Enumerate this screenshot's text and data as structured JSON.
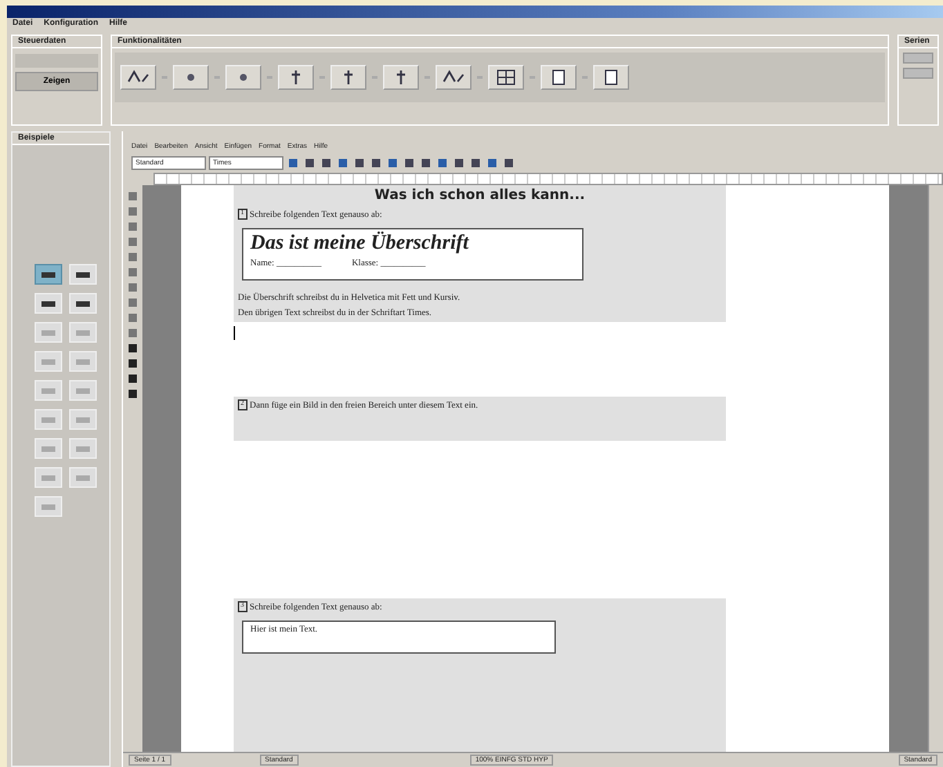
{
  "menu": [
    "Datei",
    "Konfiguration",
    "Hilfe"
  ],
  "control_group": {
    "title": "Steuerdaten",
    "button": "Zeigen"
  },
  "functions_group": {
    "title": "Funktionalitäten"
  },
  "side_group": {
    "title": "Serien"
  },
  "examples_panel": {
    "title": "Beispiele",
    "items": [
      {
        "selected": true
      },
      {
        "selected": false
      },
      {
        "selected": false
      },
      {
        "selected": false
      },
      {
        "selected": false
      },
      {
        "selected": false
      },
      {
        "selected": false
      },
      {
        "selected": false
      },
      {
        "selected": false
      },
      {
        "selected": false
      },
      {
        "selected": false
      },
      {
        "selected": false
      },
      {
        "selected": false
      },
      {
        "selected": false
      },
      {
        "selected": false
      },
      {
        "selected": false
      },
      {
        "selected": false
      }
    ]
  },
  "editor": {
    "menu": [
      "Datei",
      "Bearbeiten",
      "Ansicht",
      "Einfügen",
      "Format",
      "Extras",
      "Hilfe"
    ],
    "style_field": "Standard",
    "font_field": "Times",
    "document": {
      "heading": "Was ich schon alles kann...",
      "tasks": [
        {
          "kind": "copy",
          "number": "1",
          "instruction": "Schreibe folgenden Text genauso ab:",
          "box_title": "Das ist meine Überschrift",
          "box_fields": [
            "Name: __________",
            "Klasse: __________"
          ],
          "notes": [
            "Die Überschrift schreibst du in Helvetica mit Fett und Kursiv.",
            "Den übrigen Text schreibst du in der Schriftart Times."
          ]
        },
        {
          "kind": "image",
          "number": "2",
          "instruction": "Dann füge ein Bild in den freien Bereich unter diesem Text ein."
        },
        {
          "kind": "copytext",
          "number": "3",
          "instruction": "Schreibe folgenden Text genauso ab:",
          "box_text": "Hier ist mein Text."
        }
      ]
    },
    "status_bar": [
      "Seite 1 / 1",
      "Standard",
      "100%   EINFG   STD   HYP",
      "Standard"
    ]
  }
}
